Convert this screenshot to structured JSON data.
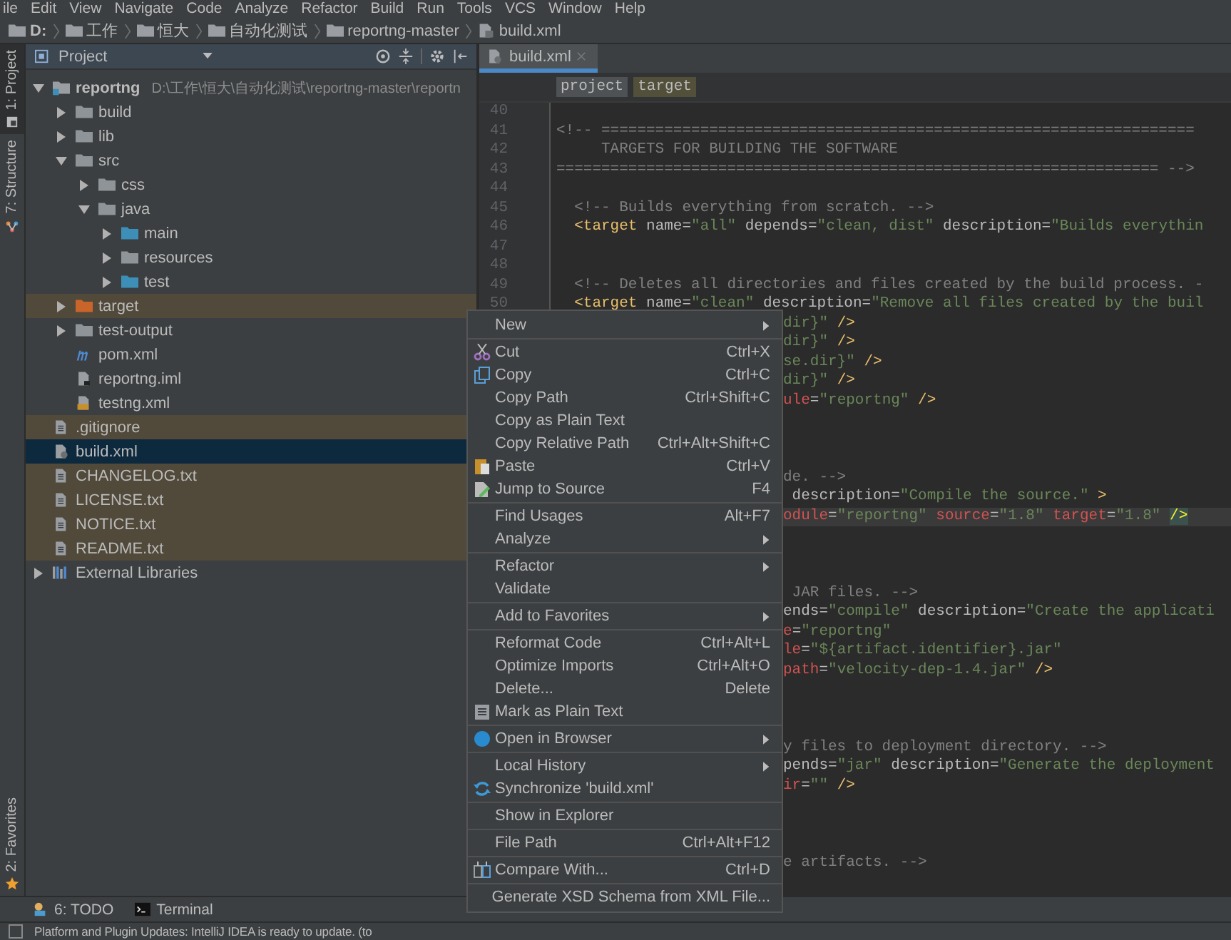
{
  "menu_bar": [
    "ile",
    "Edit",
    "View",
    "Navigate",
    "Code",
    "Analyze",
    "Refactor",
    "Build",
    "Run",
    "Tools",
    "VCS",
    "Window",
    "Help"
  ],
  "navigation_bar": [
    {
      "label": "D:",
      "kind": "drive"
    },
    {
      "label": "工作",
      "kind": "folder"
    },
    {
      "label": "恒大",
      "kind": "folder"
    },
    {
      "label": "自动化测试",
      "kind": "folder"
    },
    {
      "label": "reportng-master",
      "kind": "folder"
    },
    {
      "label": "build.xml",
      "kind": "file"
    }
  ],
  "tool_strip": {
    "top": [
      {
        "label": "1: Project",
        "selected": true
      },
      {
        "label": "7: Structure",
        "selected": false
      }
    ],
    "bottom": [
      {
        "label": "2: Favorites",
        "selected": false
      }
    ]
  },
  "project_panel": {
    "title": "Project",
    "tree": [
      {
        "label": "reportng",
        "path": "D:\\工作\\恒大\\自动化测试\\reportng-master\\reportn",
        "kind": "module",
        "expanded": true,
        "selected": false,
        "ignored": false,
        "children": [
          {
            "label": "build",
            "kind": "folder",
            "color": "#8f9498",
            "expanded": false,
            "selected": false,
            "ignored": false
          },
          {
            "label": "lib",
            "kind": "folder",
            "color": "#8f9498",
            "expanded": false,
            "selected": false,
            "ignored": false
          },
          {
            "label": "src",
            "kind": "folder",
            "color": "#8f9498",
            "expanded": true,
            "selected": false,
            "ignored": false,
            "children": [
              {
                "label": "css",
                "kind": "folder",
                "color": "#8f9498",
                "expanded": false,
                "selected": false,
                "ignored": false
              },
              {
                "label": "java",
                "kind": "folder",
                "color": "#8f9498",
                "expanded": true,
                "selected": false,
                "ignored": false,
                "children": [
                  {
                    "label": "main",
                    "kind": "folder",
                    "color": "#3d8fb8",
                    "expanded": false,
                    "selected": false,
                    "ignored": false
                  },
                  {
                    "label": "resources",
                    "kind": "folder",
                    "color": "#8f9498",
                    "expanded": false,
                    "selected": false,
                    "ignored": false
                  },
                  {
                    "label": "test",
                    "kind": "folder",
                    "color": "#3d8fb8",
                    "expanded": false,
                    "selected": false,
                    "ignored": false
                  }
                ]
              }
            ]
          },
          {
            "label": "target",
            "kind": "folder",
            "color": "#c9652b",
            "expanded": false,
            "selected": false,
            "ignored": true
          },
          {
            "label": "test-output",
            "kind": "folder",
            "color": "#8f9498",
            "expanded": false,
            "selected": false,
            "ignored": false
          },
          {
            "label": "pom.xml",
            "kind": "maven",
            "selected": false,
            "ignored": false
          },
          {
            "label": "reportng.iml",
            "kind": "iml",
            "selected": false,
            "ignored": false
          },
          {
            "label": "testng.xml",
            "kind": "xml",
            "selected": false,
            "ignored": false
          }
        ]
      },
      {
        "label": ".gitignore",
        "kind": "text",
        "selected": false,
        "ignored": true
      },
      {
        "label": "build.xml",
        "kind": "ant",
        "selected": true,
        "ignored": false
      },
      {
        "label": "CHANGELOG.txt",
        "kind": "text",
        "selected": false,
        "ignored": true
      },
      {
        "label": "LICENSE.txt",
        "kind": "text",
        "selected": false,
        "ignored": true
      },
      {
        "label": "NOTICE.txt",
        "kind": "text",
        "selected": false,
        "ignored": true
      },
      {
        "label": "README.txt",
        "kind": "text",
        "selected": false,
        "ignored": true
      },
      {
        "label": "External Libraries",
        "kind": "libraries",
        "expanded": false,
        "selected": false,
        "ignored": false
      }
    ]
  },
  "editor": {
    "tabs": [
      {
        "label": "build.xml",
        "selected": true
      }
    ],
    "breadcrumbs": [
      {
        "label": "project",
        "selected": false
      },
      {
        "label": "target",
        "selected": true
      }
    ],
    "lines": [
      {
        "number": "40",
        "covered": false,
        "current": false
      },
      {
        "number": "41",
        "covered": false,
        "current": false,
        "tokens": [
          {
            "kind": "comment",
            "text": "<!-- =================================================================="
          }
        ]
      },
      {
        "number": "42",
        "covered": false,
        "current": false,
        "tokens": [
          {
            "kind": "comment",
            "text": "     TARGETS FOR BUILDING THE SOFTWARE"
          }
        ]
      },
      {
        "number": "43",
        "covered": false,
        "current": false,
        "tokens": [
          {
            "kind": "comment",
            "text": "=================================================================== -->"
          }
        ]
      },
      {
        "number": "44",
        "covered": false,
        "current": false
      },
      {
        "number": "45",
        "covered": false,
        "current": false,
        "tokens": [
          {
            "kind": "comment",
            "text": "  <!-- Builds everything from scratch. -->"
          }
        ]
      },
      {
        "number": "46",
        "covered": false,
        "current": false,
        "tokens": [
          {
            "kind": "tag",
            "text": "  <target"
          },
          {
            "kind": "attr",
            "text": " name="
          },
          {
            "kind": "str",
            "text": "\"all\""
          },
          {
            "kind": "attr",
            "text": " depends="
          },
          {
            "kind": "str",
            "text": "\"clean, dist\""
          },
          {
            "kind": "attr",
            "text": " description="
          },
          {
            "kind": "str",
            "text": "\"Builds everythin"
          }
        ]
      },
      {
        "number": "47",
        "covered": false,
        "current": false
      },
      {
        "number": "48",
        "covered": false,
        "current": false
      },
      {
        "number": "49",
        "covered": false,
        "current": false,
        "tokens": [
          {
            "kind": "comment",
            "text": "  <!-- Deletes all directories and files created by the build process. -"
          }
        ]
      },
      {
        "number": "50",
        "covered": false,
        "current": false,
        "tokens": [
          {
            "kind": "tag",
            "text": "  <target"
          },
          {
            "kind": "attr",
            "text": " name="
          },
          {
            "kind": "str",
            "text": "\"clean\""
          },
          {
            "kind": "attr",
            "text": " description="
          },
          {
            "kind": "str",
            "text": "\"Remove all files created by the buil"
          }
        ]
      },
      {
        "covered": true,
        "current": false,
        "tokens": [
          {
            "kind": "str",
            "text": "dir}\""
          },
          {
            "kind": "tag",
            "text": " />"
          }
        ]
      },
      {
        "covered": true,
        "current": false,
        "tokens": [
          {
            "kind": "str",
            "text": "dir}\""
          },
          {
            "kind": "tag",
            "text": " />"
          }
        ]
      },
      {
        "covered": true,
        "current": false,
        "tokens": [
          {
            "kind": "str",
            "text": "se.dir}\""
          },
          {
            "kind": "tag",
            "text": " />"
          }
        ]
      },
      {
        "covered": true,
        "current": false,
        "tokens": [
          {
            "kind": "str",
            "text": "dir}\""
          },
          {
            "kind": "tag",
            "text": " />"
          }
        ]
      },
      {
        "covered": true,
        "current": false,
        "tokens": [
          {
            "kind": "err",
            "text": "ule"
          },
          {
            "kind": "attr",
            "text": "="
          },
          {
            "kind": "str",
            "text": "\"reportng\""
          },
          {
            "kind": "tag",
            "text": " />"
          }
        ]
      },
      {
        "covered": true,
        "current": false
      },
      {
        "covered": true,
        "current": false
      },
      {
        "covered": true,
        "current": false
      },
      {
        "covered": true,
        "current": false,
        "tokens": [
          {
            "kind": "comment",
            "text": "de. -->"
          }
        ]
      },
      {
        "covered": true,
        "current": false,
        "tokens": [
          {
            "kind": "attr",
            "text": " description="
          },
          {
            "kind": "str",
            "text": "\"Compile the source.\""
          },
          {
            "kind": "tag",
            "text": " >"
          }
        ]
      },
      {
        "covered": true,
        "current": true,
        "tokens": [
          {
            "kind": "err",
            "text": "odule"
          },
          {
            "kind": "attr",
            "text": "="
          },
          {
            "kind": "str",
            "text": "\"reportng\""
          },
          {
            "kind": "err",
            "text": " source"
          },
          {
            "kind": "attr",
            "text": "="
          },
          {
            "kind": "str",
            "text": "\"1.8\""
          },
          {
            "kind": "err",
            "text": " target"
          },
          {
            "kind": "attr",
            "text": "="
          },
          {
            "kind": "str",
            "text": "\"1.8\" "
          },
          {
            "kind": "match",
            "text": "/>"
          }
        ]
      },
      {
        "covered": true,
        "current": false
      },
      {
        "covered": true,
        "current": false
      },
      {
        "covered": true,
        "current": false
      },
      {
        "covered": true,
        "current": false,
        "tokens": [
          {
            "kind": "comment",
            "text": " JAR files. -->"
          }
        ]
      },
      {
        "covered": true,
        "current": false,
        "tokens": [
          {
            "kind": "attr",
            "text": "ends="
          },
          {
            "kind": "str",
            "text": "\"compile\""
          },
          {
            "kind": "attr",
            "text": " description="
          },
          {
            "kind": "str",
            "text": "\"Create the applicati"
          }
        ]
      },
      {
        "covered": true,
        "current": false,
        "tokens": [
          {
            "kind": "err",
            "text": "e"
          },
          {
            "kind": "attr",
            "text": "="
          },
          {
            "kind": "str",
            "text": "\"reportng\""
          }
        ]
      },
      {
        "covered": true,
        "current": false,
        "tokens": [
          {
            "kind": "err",
            "text": "le"
          },
          {
            "kind": "attr",
            "text": "="
          },
          {
            "kind": "str",
            "text": "\"${artifact.identifier}.jar\""
          }
        ]
      },
      {
        "covered": true,
        "current": false,
        "tokens": [
          {
            "kind": "err",
            "text": "path"
          },
          {
            "kind": "attr",
            "text": "="
          },
          {
            "kind": "str",
            "text": "\"velocity-dep-1.4.jar\""
          },
          {
            "kind": "tag",
            "text": " />"
          }
        ]
      },
      {
        "covered": true,
        "current": false
      },
      {
        "covered": true,
        "current": false
      },
      {
        "covered": true,
        "current": false
      },
      {
        "covered": true,
        "current": false,
        "tokens": [
          {
            "kind": "comment",
            "text": "y files to deployment directory. -->"
          }
        ]
      },
      {
        "covered": true,
        "current": false,
        "tokens": [
          {
            "kind": "attr",
            "text": "pends="
          },
          {
            "kind": "str",
            "text": "\"jar\""
          },
          {
            "kind": "attr",
            "text": " description="
          },
          {
            "kind": "str",
            "text": "\"Generate the deployment"
          }
        ]
      },
      {
        "covered": true,
        "current": false,
        "tokens": [
          {
            "kind": "err",
            "text": "ir"
          },
          {
            "kind": "attr",
            "text": "="
          },
          {
            "kind": "str",
            "text": "\"\""
          },
          {
            "kind": "tag",
            "text": " />"
          }
        ]
      },
      {
        "covered": true,
        "current": false
      },
      {
        "covered": true,
        "current": false
      },
      {
        "covered": true,
        "current": false
      },
      {
        "covered": true,
        "current": false,
        "tokens": [
          {
            "kind": "comment",
            "text": "e artifacts. -->"
          }
        ]
      }
    ]
  },
  "context_menu": {
    "groups": [
      [
        {
          "label": "New",
          "submenu": true
        }
      ],
      [
        {
          "label": "Cut",
          "shortcut": "Ctrl+X",
          "submenu": false
        },
        {
          "label": "Copy",
          "shortcut": "Ctrl+C",
          "submenu": false
        },
        {
          "label": "Copy Path",
          "shortcut": "Ctrl+Shift+C",
          "submenu": false
        },
        {
          "label": "Copy as Plain Text",
          "submenu": false
        },
        {
          "label": "Copy Relative Path",
          "shortcut": "Ctrl+Alt+Shift+C",
          "submenu": false
        },
        {
          "label": "Paste",
          "shortcut": "Ctrl+V",
          "submenu": false
        },
        {
          "label": "Jump to Source",
          "shortcut": "F4",
          "submenu": false
        }
      ],
      [
        {
          "label": "Find Usages",
          "shortcut": "Alt+F7",
          "submenu": false
        },
        {
          "label": "Analyze",
          "submenu": true
        }
      ],
      [
        {
          "label": "Refactor",
          "submenu": true
        },
        {
          "label": "Validate",
          "submenu": false
        }
      ],
      [
        {
          "label": "Add to Favorites",
          "submenu": true
        }
      ],
      [
        {
          "label": "Reformat Code",
          "shortcut": "Ctrl+Alt+L",
          "submenu": false
        },
        {
          "label": "Optimize Imports",
          "shortcut": "Ctrl+Alt+O",
          "submenu": false
        },
        {
          "label": "Delete...",
          "shortcut": "Delete",
          "submenu": false
        },
        {
          "label": "Mark as Plain Text",
          "submenu": false
        }
      ],
      [
        {
          "label": "Open in Browser",
          "submenu": true
        }
      ],
      [
        {
          "label": "Local History",
          "submenu": true
        },
        {
          "label": "Synchronize 'build.xml'",
          "submenu": false
        }
      ],
      [
        {
          "label": "Show in Explorer",
          "submenu": false
        }
      ],
      [
        {
          "label": "File Path",
          "shortcut": "Ctrl+Alt+F12",
          "submenu": false
        }
      ],
      [
        {
          "label": "Compare With...",
          "shortcut": "Ctrl+D",
          "submenu": false
        }
      ],
      [
        {
          "label": "Generate XSD Schema from XML File...",
          "submenu": false
        }
      ]
    ]
  },
  "tool_bar": [
    {
      "label": "6: TODO"
    },
    {
      "label": "Terminal"
    }
  ],
  "status_bar": "Platform and Plugin Updates: IntelliJ IDEA is ready to update. (to"
}
